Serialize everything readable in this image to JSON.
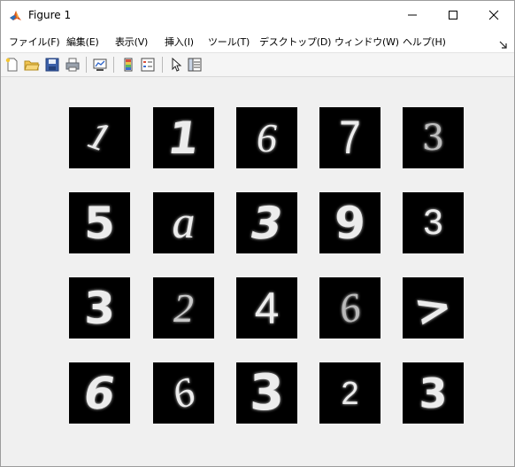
{
  "window": {
    "title": "Figure 1",
    "app_icon": "matlab-icon",
    "controls": [
      "minimize-icon",
      "maximize-icon",
      "close-icon"
    ]
  },
  "menubar": {
    "items": [
      {
        "label": "ファイル(F)"
      },
      {
        "label": "編集(E)"
      },
      {
        "label": "表示(V)"
      },
      {
        "label": "挿入(I)"
      },
      {
        "label": "ツール(T)"
      },
      {
        "label": "デスクトップ(D)"
      },
      {
        "label": "ウィンドウ(W)"
      },
      {
        "label": "ヘルプ(H)"
      }
    ],
    "dock_icon": "dock-arrow-icon"
  },
  "toolbar": {
    "icons": [
      "new-figure-icon",
      "open-file-icon",
      "save-icon",
      "print-icon",
      "link-plot-icon",
      "colorbar-icon",
      "legend-icon",
      "edit-plot-icon",
      "property-inspector-icon"
    ]
  },
  "figure": {
    "rows": [
      [
        "1",
        "1",
        "6",
        "7",
        "3"
      ],
      [
        "5",
        "a",
        "3",
        "9",
        "3"
      ],
      [
        "3",
        "2",
        "4",
        "6",
        ">"
      ],
      [
        "6",
        "6",
        "3",
        "2",
        "3"
      ]
    ]
  }
}
